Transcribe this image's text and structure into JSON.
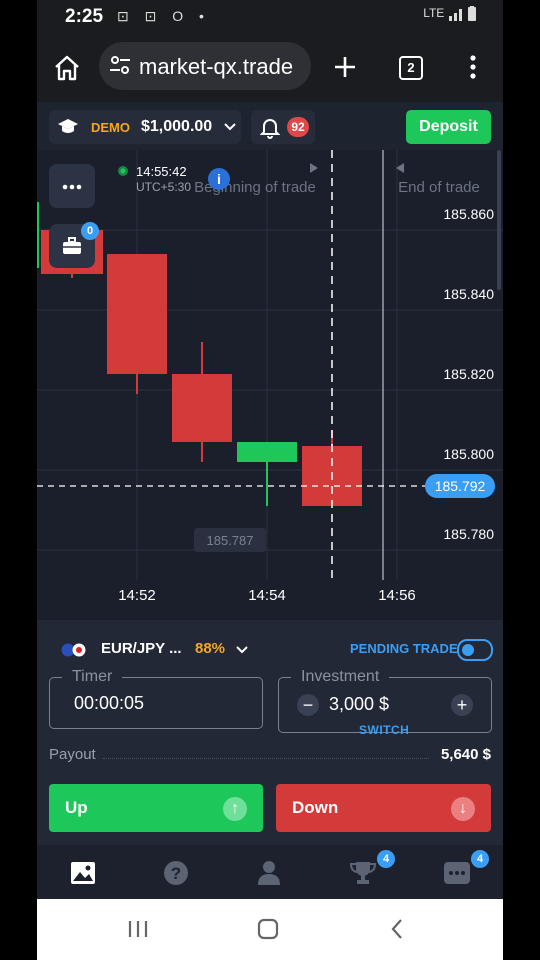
{
  "status_bar": {
    "time": "2:25",
    "indicators": "⊡ ⊡ Ο •",
    "network": "LTE"
  },
  "browser": {
    "url": "market-qx.trade",
    "tab_count": "2"
  },
  "account": {
    "mode": "DEMO",
    "balance": "$1,000.00",
    "notifications": "92",
    "deposit_label": "Deposit"
  },
  "chart": {
    "clock_time": "14:55:42",
    "timezone": "UTC+5:30",
    "beginning_label": "Beginning of trade",
    "end_label": "End of trade",
    "open_trades": "0",
    "current_price": "185.792",
    "hover_price": "185.787",
    "info_icon": "i"
  },
  "chart_data": {
    "type": "candlestick",
    "x_ticks": [
      "14:52",
      "14:54",
      "14:56"
    ],
    "y_ticks": [
      "185.860",
      "185.840",
      "185.820",
      "185.800",
      "185.780"
    ],
    "y_tick_values": [
      185.86,
      185.84,
      185.82,
      185.8,
      185.78
    ],
    "candles": [
      {
        "open": 185.856,
        "close": 185.845,
        "high": 185.857,
        "low": 185.844,
        "color": "red"
      },
      {
        "open": 185.85,
        "close": 185.82,
        "high": 185.85,
        "low": 185.815,
        "color": "red"
      },
      {
        "open": 185.82,
        "close": 185.803,
        "high": 185.828,
        "low": 185.798,
        "color": "red"
      },
      {
        "open": 185.798,
        "close": 185.803,
        "high": 185.803,
        "low": 185.787,
        "color": "green"
      },
      {
        "open": 185.802,
        "close": 185.787,
        "high": 185.806,
        "low": 185.787,
        "color": "red"
      }
    ],
    "colors": {
      "up": "#1ec75a",
      "down": "#d33a3a",
      "price_line": "#3b9ef5"
    }
  },
  "trade_panel": {
    "asset": "EUR/JPY ...",
    "payout_pct": "88%",
    "pending_label": "PENDING TRADE",
    "timer_label": "Timer",
    "timer_value": "00:00:05",
    "investment_label": "Investment",
    "investment_value": "3,000 $",
    "minus": "−",
    "plus": "+",
    "switch_label": "SWITCH",
    "payout_label": "Payout",
    "payout_value": "5,640 $",
    "up_label": "Up",
    "down_label": "Down"
  },
  "bottom_nav": {
    "trophy_badge": "4",
    "chat_badge": "4"
  },
  "ui_colors": {
    "accent": "#3b9ef5",
    "up": "#1ec75a",
    "down": "#d33a3a",
    "demo": "#f5a623"
  }
}
